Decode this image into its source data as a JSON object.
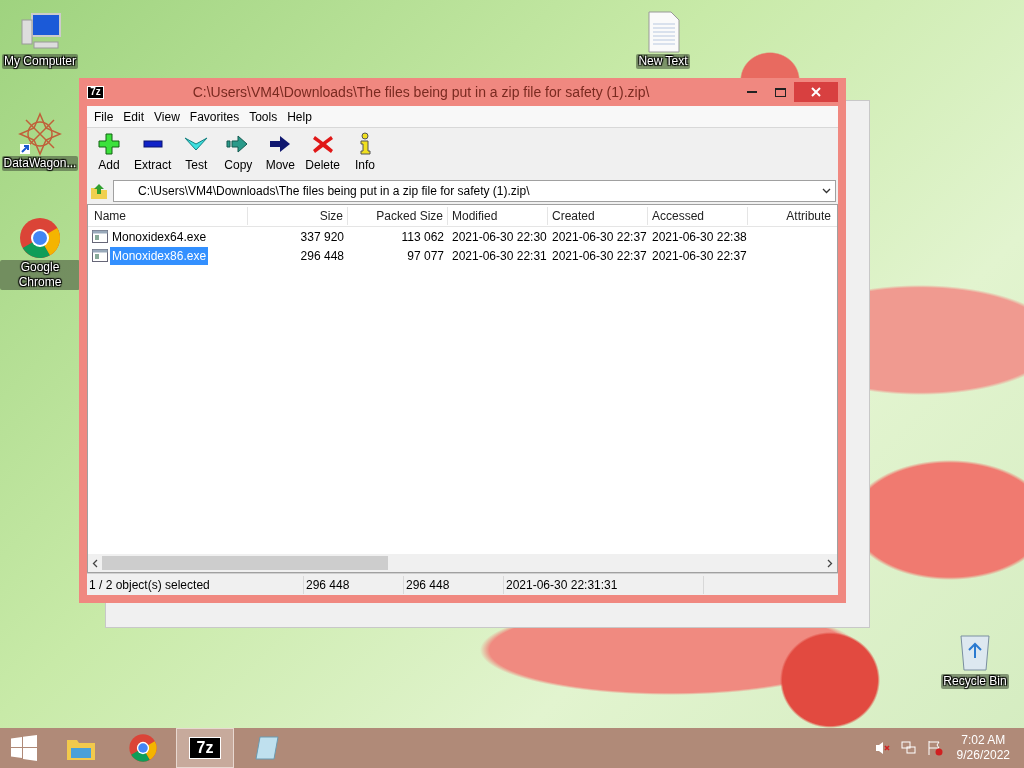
{
  "desktop_icons": [
    {
      "kind": "computer",
      "label": "My Computer"
    },
    {
      "kind": "shortcut_app",
      "label": "DataWagon..."
    },
    {
      "kind": "chrome",
      "label": "Google Chrome"
    },
    {
      "kind": "text_file",
      "label": "New Text"
    },
    {
      "kind": "recycle_bin",
      "label": "Recycle Bin"
    }
  ],
  "window": {
    "logo": "7z",
    "title": "C:\\Users\\VM4\\Downloads\\The files being put in a zip file for safety (1).zip\\",
    "menu": [
      "File",
      "Edit",
      "View",
      "Favorites",
      "Tools",
      "Help"
    ],
    "toolbar": [
      {
        "kind": "add",
        "label": "Add"
      },
      {
        "kind": "extract",
        "label": "Extract"
      },
      {
        "kind": "test",
        "label": "Test"
      },
      {
        "kind": "copy",
        "label": "Copy"
      },
      {
        "kind": "move",
        "label": "Move"
      },
      {
        "kind": "delete",
        "label": "Delete"
      },
      {
        "kind": "info",
        "label": "Info"
      }
    ],
    "address": "C:\\Users\\VM4\\Downloads\\The files being put in a zip file for safety (1).zip\\",
    "columns": [
      "Name",
      "Size",
      "Packed Size",
      "Modified",
      "Created",
      "Accessed",
      "Attribute"
    ],
    "rows": [
      {
        "selected": false,
        "cells": [
          "Monoxidex64.exe",
          "337 920",
          "113 062",
          "2021-06-30 22:30",
          "2021-06-30 22:37",
          "2021-06-30 22:38"
        ]
      },
      {
        "selected": true,
        "cells": [
          "Monoxidex86.exe",
          "296 448",
          "97 077",
          "2021-06-30 22:31",
          "2021-06-30 22:37",
          "2021-06-30 22:37"
        ]
      }
    ],
    "status_bar": [
      "1 / 2 object(s) selected",
      "296 448",
      "296 448",
      "2021-06-30 22:31:31"
    ]
  },
  "taskbar": {
    "items": [
      {
        "kind": "explorer",
        "active": false
      },
      {
        "kind": "chrome",
        "active": false
      },
      {
        "kind": "sevenzip",
        "active": true,
        "logo": "7z"
      },
      {
        "kind": "notepad",
        "active": false
      }
    ],
    "time": "7:02 AM",
    "date": "9/26/2022"
  }
}
